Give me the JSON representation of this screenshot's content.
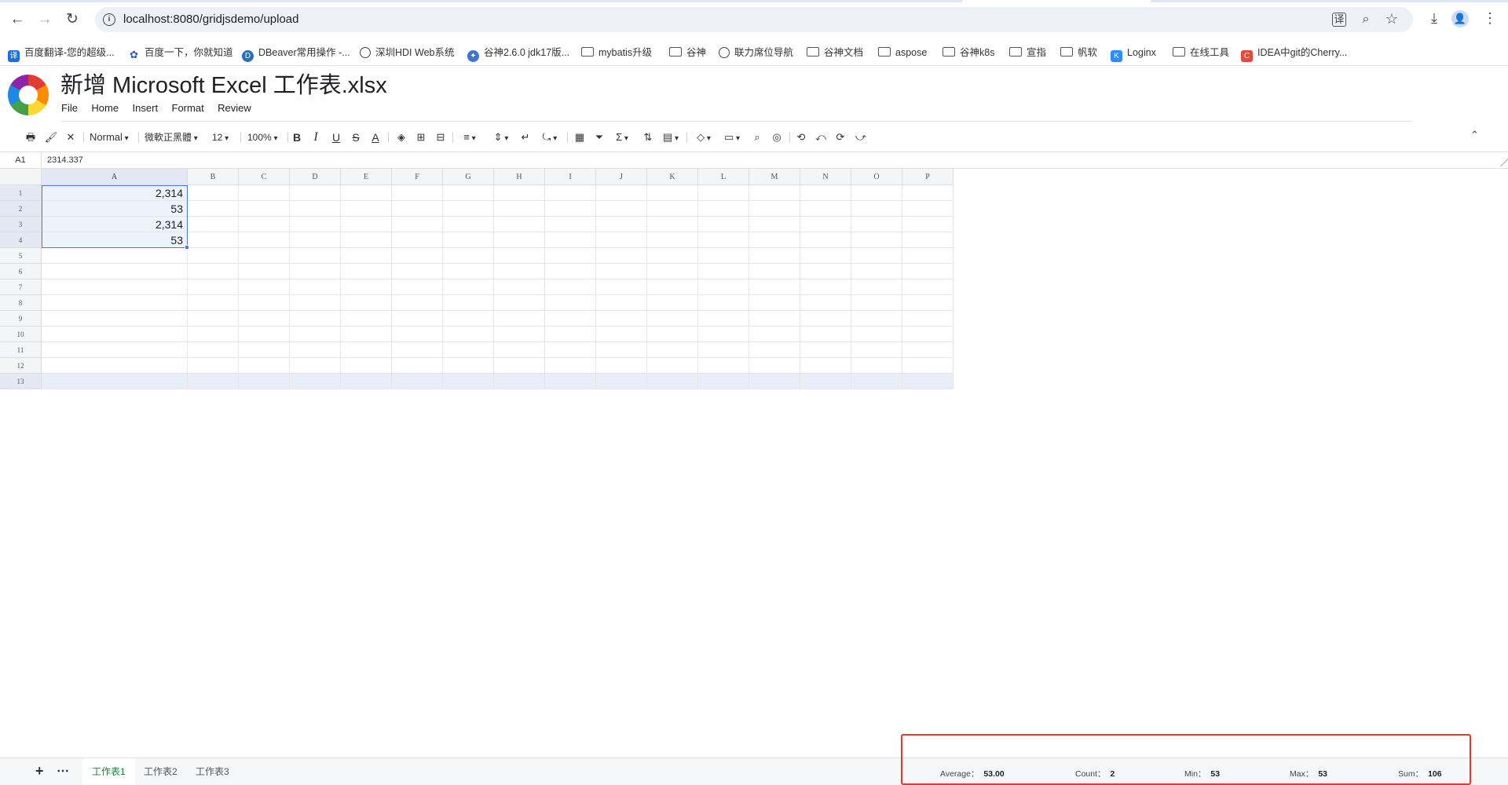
{
  "browser": {
    "url": "localhost:8080/gridjsdemo/upload",
    "nav": {
      "back": "←",
      "forward": "→",
      "reload": "↻"
    },
    "icons": {
      "translate": "译",
      "zoom": "⌕",
      "star": "☆",
      "download": "⤓",
      "profile": "👤",
      "menu": "⋮",
      "info": "i"
    }
  },
  "bookmarks": [
    {
      "label": "百度翻译-您的超级...",
      "icon": "blue",
      "glyph": "译"
    },
    {
      "label": "百度一下，你就知道",
      "icon": "paw",
      "glyph": "✿"
    },
    {
      "label": "DBeaver常用操作 -...",
      "icon": "dbeaver",
      "glyph": "D"
    },
    {
      "label": "深圳HDI Web系统",
      "icon": "globe",
      "glyph": ""
    },
    {
      "label": "谷神2.6.0 jdk17版...",
      "icon": "globe2",
      "glyph": "✦"
    },
    {
      "label": "mybatis升级",
      "icon": "folder",
      "glyph": ""
    },
    {
      "label": "谷神",
      "icon": "folder",
      "glyph": ""
    },
    {
      "label": "联力席位导航",
      "icon": "globe",
      "glyph": ""
    },
    {
      "label": "谷神文档",
      "icon": "folder",
      "glyph": ""
    },
    {
      "label": "aspose",
      "icon": "folder",
      "glyph": ""
    },
    {
      "label": "谷神k8s",
      "icon": "folder",
      "glyph": ""
    },
    {
      "label": "宣指",
      "icon": "folder",
      "glyph": ""
    },
    {
      "label": "帆软",
      "icon": "folder",
      "glyph": ""
    },
    {
      "label": "Loginx",
      "icon": "kblue",
      "glyph": "K"
    },
    {
      "label": "在线工具",
      "icon": "folder",
      "glyph": ""
    },
    {
      "label": "IDEA中git的Cherry...",
      "icon": "cred",
      "glyph": "C"
    }
  ],
  "app": {
    "title": "新增 Microsoft Excel 工作表.xlsx",
    "menu": [
      "File",
      "Home",
      "Insert",
      "Format",
      "Review"
    ]
  },
  "toolbar": {
    "print": "🖶",
    "paint_format": "🖌",
    "clear_format": "✕",
    "style": "Normal",
    "font": "微軟正黑體",
    "font_size": "12",
    "zoom": "100%",
    "bold": "B",
    "italic": "I",
    "underline": "U",
    "strike": "S",
    "text_color": "A",
    "fill": "◈",
    "borders": "⊞",
    "merge": "⊟",
    "align": "≡",
    "valign": "⇕",
    "wrap": "↵",
    "rotate": "⤿",
    "table": "▦",
    "filter": "⏷",
    "sum": "Σ",
    "sort": "⇅",
    "chart": "▤",
    "shapes": "◇",
    "textbox": "▭",
    "search": "⌕",
    "image": "◎",
    "undo1": "⟲",
    "undo2": "⤺",
    "redo1": "⟳",
    "redo2": "⤻",
    "collapse": "⌃"
  },
  "formula_bar": {
    "cell_ref": "A1",
    "value": "2314.337"
  },
  "grid": {
    "columns": [
      "A",
      "B",
      "C",
      "D",
      "E",
      "F",
      "G",
      "H",
      "I",
      "J",
      "K",
      "L",
      "M",
      "N",
      "O",
      "P"
    ],
    "rows": [
      "1",
      "2",
      "3",
      "4",
      "5",
      "6",
      "7",
      "8",
      "9",
      "10",
      "11",
      "12",
      "13"
    ],
    "cells": {
      "A1": "2,314",
      "A2": "53",
      "A3": "2,314",
      "A4": "53"
    },
    "selection_color": "#4a7cdb"
  },
  "sheets": {
    "add": "+",
    "more": "⋯",
    "tabs": [
      "工作表1",
      "工作表2",
      "工作表3"
    ],
    "active": 0
  },
  "stats": [
    {
      "label": "Average：",
      "value": "53.00"
    },
    {
      "label": "Count：",
      "value": "2"
    },
    {
      "label": "Min：",
      "value": "53"
    },
    {
      "label": "Max：",
      "value": "53"
    },
    {
      "label": "Sum：",
      "value": "106"
    }
  ],
  "colors": {
    "accent": "#1e7e34",
    "highlight_box": "#e03a2f"
  }
}
